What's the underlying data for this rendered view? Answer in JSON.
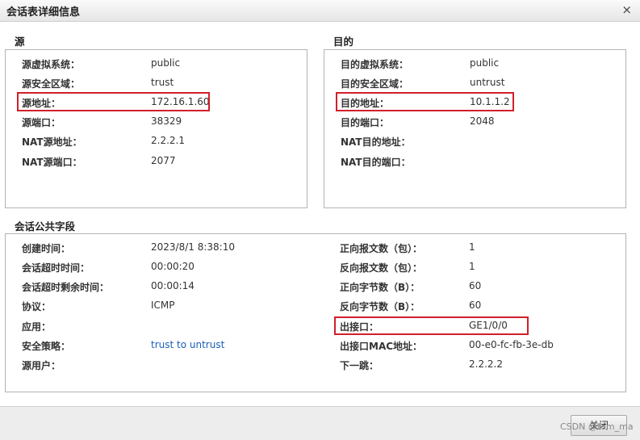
{
  "dialog": {
    "title": "会话表详细信息",
    "close_glyph": "×",
    "close_button": "关闭"
  },
  "source": {
    "title": "源",
    "rows": [
      {
        "label": "源虚拟系统：",
        "value": "public"
      },
      {
        "label": "源安全区域：",
        "value": "trust"
      },
      {
        "label": "源地址：",
        "value": "172.16.1.60"
      },
      {
        "label": "源端口：",
        "value": "38329"
      },
      {
        "label": "NAT源地址：",
        "value": "2.2.2.1"
      },
      {
        "label": "NAT源端口：",
        "value": "2077"
      }
    ]
  },
  "destination": {
    "title": "目的",
    "rows": [
      {
        "label": "目的虚拟系统：",
        "value": "public"
      },
      {
        "label": "目的安全区域：",
        "value": "untrust"
      },
      {
        "label": "目的地址：",
        "value": "10.1.1.2"
      },
      {
        "label": "目的端口：",
        "value": "2048"
      },
      {
        "label": "NAT目的地址：",
        "value": ""
      },
      {
        "label": "NAT目的端口：",
        "value": ""
      }
    ]
  },
  "common": {
    "title": "会话公共字段",
    "left": [
      {
        "label": "创建时间：",
        "value": "2023/8/1 8:38:10"
      },
      {
        "label": "会话超时时间：",
        "value": "00:00:20"
      },
      {
        "label": "会话超时剩余时间：",
        "value": "00:00:14"
      },
      {
        "label": "协议：",
        "value": "ICMP"
      },
      {
        "label": "应用：",
        "value": ""
      },
      {
        "label": "安全策略：",
        "value": "trust to untrust"
      },
      {
        "label": "源用户：",
        "value": ""
      }
    ],
    "right": [
      {
        "label": "正向报文数（包）：",
        "value": "1"
      },
      {
        "label": "反向报文数（包）：",
        "value": "1"
      },
      {
        "label": "正向字节数（B）：",
        "value": "60"
      },
      {
        "label": "反向字节数（B）：",
        "value": "60"
      },
      {
        "label": "出接口：",
        "value": "GE1/0/0"
      },
      {
        "label": "出接口MAC地址：",
        "value": "00-e0-fc-fb-3e-db"
      },
      {
        "label": "下一跳：",
        "value": "2.2.2.2"
      }
    ]
  },
  "watermark": "CSDN @tom_ma",
  "colors": {
    "highlight": "#d0202a",
    "link": "#1b5fb8"
  }
}
